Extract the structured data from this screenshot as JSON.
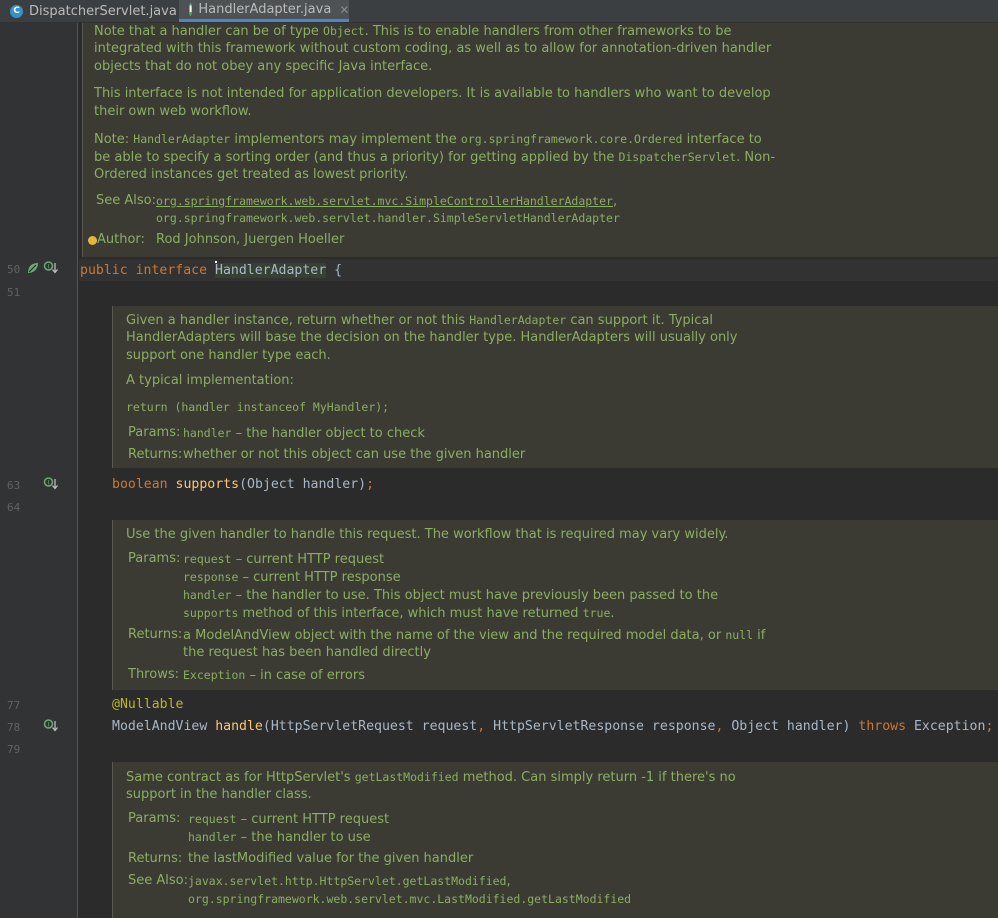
{
  "tabs": [
    {
      "label": "DispatcherServlet.java",
      "icon": "class-icon",
      "icon_letter": "C",
      "icon_color": "#3592c4",
      "active": false
    },
    {
      "label": "HandlerAdapter.java",
      "icon": "interface-icon",
      "icon_letter": "I",
      "icon_color": "#59a869",
      "active": true
    }
  ],
  "line_numbers": [
    "50",
    "51",
    "63",
    "64",
    "77",
    "78",
    "79"
  ],
  "doc1": {
    "p1_l1a": "Note that a handler can be of type ",
    "p1_l1_code": "Object",
    "p1_l1b": ". This is to enable handlers from other frameworks to be",
    "p1_l2": "integrated with this framework without custom coding, as well as to allow for annotation-driven handler",
    "p1_l3": "objects that do not obey any specific Java interface.",
    "p2_l1": "This interface is not intended for application developers. It is available to handlers who want to develop",
    "p2_l2": "their own web workflow.",
    "p3_l1a": "Note: ",
    "p3_l1_code": "HandlerAdapter",
    "p3_l1b": " implementors may implement the ",
    "p3_l1_link": "org.springframework.core.Ordered",
    "p3_l1c": " interface to",
    "p3_l2a": "be able to specify a sorting order (and thus a priority) for getting applied by the ",
    "p3_l2_code": "DispatcherServlet",
    "p3_l2b": ". Non-",
    "p3_l3": "Ordered instances get treated as lowest priority.",
    "see_also_label": "See Also:",
    "see_also_1": "org.springframework.web.servlet.mvc.SimpleControllerHandlerAdapter",
    "see_also_1_sep": ",",
    "see_also_2": "org.springframework.web.servlet.handler.SimpleServletHandlerAdapter",
    "author_label": "Author:",
    "author_value": "Rod Johnson, Juergen Hoeller"
  },
  "line50": {
    "kw1": "public",
    "kw2": "interface",
    "name": "HandlerAdapter",
    "brace": " {"
  },
  "doc2": {
    "l1a": "Given a handler instance, return whether or not this ",
    "l1_code": "HandlerAdapter",
    "l1b": " can support it. Typical",
    "l2": "HandlerAdapters will base the decision on the handler type. HandlerAdapters will usually only",
    "l3": "support one handler type each.",
    "l4": "A typical implementation:",
    "l5_code": "return (handler instanceof MyHandler);",
    "params_label": "Params:",
    "param_name": "handler",
    "param_desc": " – the handler object to check",
    "returns_label": "Returns:",
    "returns_desc": "whether or not this object can use the given handler"
  },
  "line63": {
    "type": "boolean",
    "method": "supports",
    "args": "(Object handler)",
    "semi": ";"
  },
  "doc3": {
    "l1": "Use the given handler to handle this request. The workflow that is required may vary widely.",
    "params_label": "Params:",
    "p1_name": "request",
    "p1_desc": " – current HTTP request",
    "p2_name": "response",
    "p2_desc": " – current HTTP response",
    "p3_name": "handler",
    "p3_desc": " – the handler to use. This object must have previously been passed to the",
    "p3_l2_code": "supports",
    "p3_l2": " method of this interface, which must have returned ",
    "p3_l2_code2": "true",
    "p3_l2_end": ".",
    "returns_label": "Returns:",
    "returns_l1a": "a ModelAndView object with the name of the view and the required model data, or ",
    "returns_l1_code": "null",
    "returns_l1b": " if",
    "returns_l2": "the request has been handled directly",
    "throws_label": "Throws:",
    "throws_link": "Exception",
    "throws_desc": " – in case of errors"
  },
  "line77": {
    "annotation": "@Nullable"
  },
  "line78": {
    "type": "ModelAndView",
    "method": "handle",
    "p1": "(HttpServletRequest request",
    "comma1": ",",
    "p2": " HttpServletResponse response",
    "comma2": ",",
    "p3": " Object handler) ",
    "throws": "throws",
    "exc": " Exception",
    "semi": ";"
  },
  "doc4": {
    "l1a": "Same contract as for HttpServlet's ",
    "l1_code": "getLastModified",
    "l1b": " method. Can simply return -1 if there's no",
    "l2": "support in the handler class.",
    "params_label": "Params:",
    "p1_name": "request",
    "p1_desc": " – current HTTP request",
    "p2_name": "handler",
    "p2_desc": " – the handler to use",
    "returns_label": "Returns:",
    "returns_desc": "the lastModified value for the given handler",
    "see_also_label": "See Also:",
    "see_1": "javax.servlet.http.HttpServlet.getLastModified",
    "see_1_sep": ",",
    "see_2": "org.springframework.web.servlet.mvc.LastModified.getLastModified"
  }
}
